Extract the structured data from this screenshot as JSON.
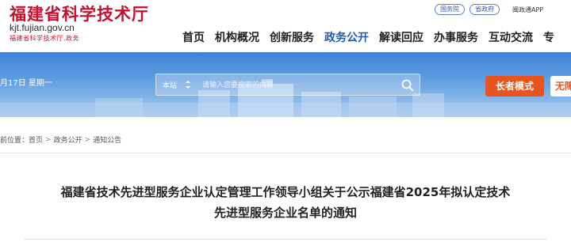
{
  "header": {
    "logo_title": "福建省科学技术厅",
    "logo_domain": "kjt.fujian.gov.cn",
    "logo_domain_cn": "福建省科学技术厅.政务",
    "top_links": [
      "国务院",
      "省政府"
    ],
    "app_link": "闽政通APP",
    "nav": [
      "首页",
      "机构概况",
      "创新服务",
      "政务公开",
      "解读回应",
      "办事服务",
      "互动交流",
      "专"
    ],
    "active_nav": "政务公开"
  },
  "banner": {
    "date": "月17日 星期一",
    "search_scope": "本站",
    "search_placeholder": "请输入您要搜索的内容",
    "elder_mode": "长者模式",
    "accessibility": "无障"
  },
  "breadcrumb": {
    "prefix": "前位置：",
    "items": [
      "首页",
      "政务公开",
      "通知公告"
    ]
  },
  "article": {
    "title_line1": "福建省技术先进型服务企业认定管理工作领导小组关于公示福建省2025年拟认定技术",
    "title_line2": "先进型服务企业名单的通知"
  },
  "colors": {
    "brand_red": "#c8102e",
    "nav_active": "#1e5bb5",
    "elder_orange": "#e8541e"
  }
}
